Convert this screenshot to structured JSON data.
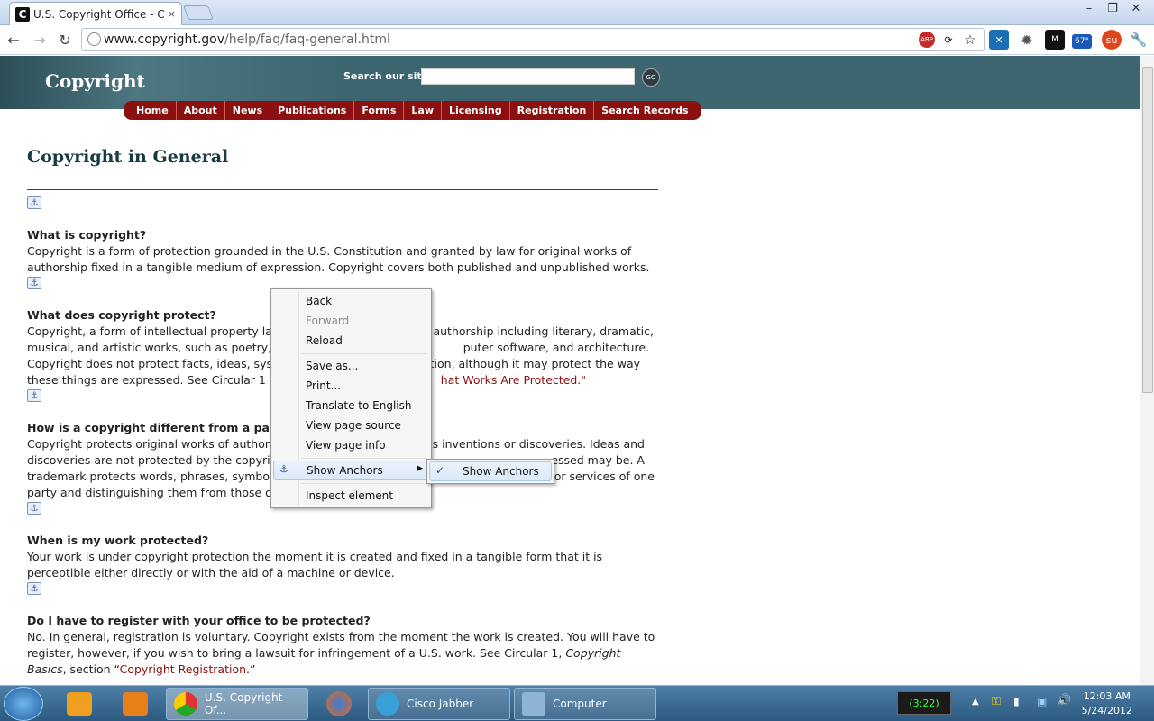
{
  "browser": {
    "tab_title": "U.S. Copyright Office - Cop",
    "tab_close": "×",
    "url_domain": "www.copyright.gov",
    "url_path": "/help/faq/faq-general.html",
    "weather": "67°"
  },
  "site": {
    "logo": "Copyright",
    "search_label": "Search our site",
    "search_placeholder": "",
    "go_label": "GO",
    "nav": [
      "Home",
      "About",
      "News",
      "Publications",
      "Forms",
      "Law",
      "Licensing",
      "Registration",
      "Search Records"
    ]
  },
  "page": {
    "title": "Copyright in General",
    "faqs": [
      {
        "q": "What is copyright?",
        "a": "Copyright is a form of protection grounded in the U.S. Constitution and granted by law for original works of authorship fixed in a tangible medium of expression. Copyright covers both published and unpublished works."
      },
      {
        "q": "What does copyright protect?",
        "a1": "Copyright, a form of intellectual property la",
        "a2": "authorship including literary, dramatic,",
        "a3": "musical, and artistic works, such as poetry,",
        "a4": "puter software, and architecture.",
        "a5": "Copyright does not protect facts, ideas, sys",
        "a6": "tion, although it may protect the way",
        "a7": "these things are expressed. See Circular 1",
        "a8": "hat Works Are Protected.\""
      },
      {
        "q": "How is a copyright different from a paten",
        "a1": "Copyright protects original works of author",
        "a2": "s inventions or discoveries. Ideas and",
        "a3": "discoveries are not protected by the copyri",
        "a4": "essed may be. A",
        "a5": "trademark protects words, phrases, symbo",
        "a6": "or services of one",
        "a7": "party and distinguishing them from those o"
      },
      {
        "q": "When is my work protected?",
        "a": "Your work is under copyright protection the moment it is created and fixed in a tangible form that it is perceptible either directly or with the aid of a machine or device."
      },
      {
        "q": "Do I have to register with your office to be protected?",
        "a_pre": "No. In general, registration is voluntary. Copyright exists from the moment the work is created. You will have to register, however, if you wish to bring a lawsuit for infringement of a U.S. work. See Circular 1, ",
        "a_em": "Copyright Basics",
        "a_mid": ", section “",
        "a_link": "Copyright Registration",
        "a_post": ".”"
      }
    ]
  },
  "context_menu": {
    "items": [
      "Back",
      "Forward",
      "Reload",
      "Save as...",
      "Print...",
      "Translate to English",
      "View page source",
      "View page info",
      "Show Anchors",
      "Inspect element"
    ],
    "submenu_item": "Show Anchors",
    "submenu_check": "✓"
  },
  "taskbar": {
    "chrome_label": "U.S. Copyright Of...",
    "jabber_label": "Cisco Jabber",
    "computer_label": "Computer",
    "battery": "(3:22)",
    "time": "12:03 AM",
    "date": "5/24/2012"
  }
}
